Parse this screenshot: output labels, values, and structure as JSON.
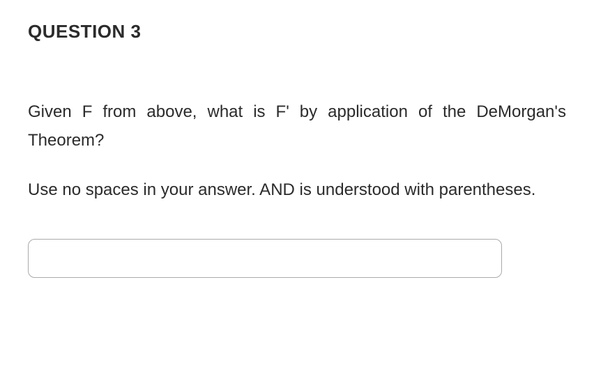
{
  "question": {
    "title": "QUESTION 3",
    "paragraph1": "Given F from above, what is F' by application of the DeMorgan's Theorem?",
    "paragraph2": "Use no spaces in your answer. AND is understood with parentheses."
  },
  "answer": {
    "value": "",
    "placeholder": ""
  }
}
